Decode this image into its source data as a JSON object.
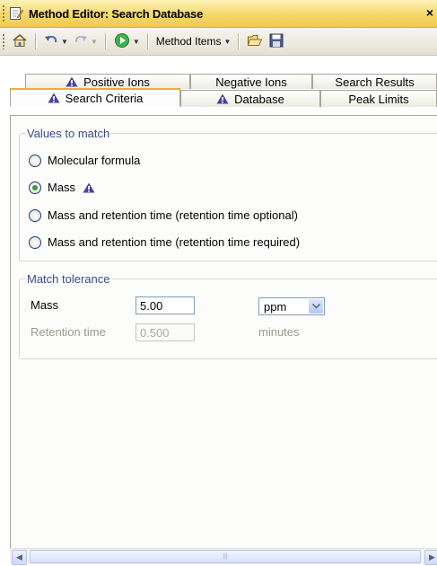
{
  "window": {
    "title": "Method Editor: Search Database",
    "close_label": "×"
  },
  "toolbar": {
    "method_items_label": "Method Items"
  },
  "tabs": {
    "row_back": [
      {
        "label": "Positive Ions",
        "warning": true
      },
      {
        "label": "Negative Ions",
        "warning": false
      },
      {
        "label": "Search Results",
        "warning": false
      }
    ],
    "row_front": [
      {
        "label": "Search Criteria",
        "warning": true,
        "active": true
      },
      {
        "label": "Database",
        "warning": true,
        "active": false
      },
      {
        "label": "Peak Limits",
        "warning": false,
        "active": false
      }
    ]
  },
  "values_to_match": {
    "legend": "Values to match",
    "options": [
      {
        "label": "Molecular formula",
        "checked": false,
        "warning": false
      },
      {
        "label": "Mass",
        "checked": true,
        "warning": true
      },
      {
        "label": "Mass and retention time (retention time optional)",
        "checked": false,
        "warning": false
      },
      {
        "label": "Mass and retention time (retention time required)",
        "checked": false,
        "warning": false
      }
    ]
  },
  "match_tolerance": {
    "legend": "Match tolerance",
    "mass_label": "Mass",
    "mass_value": "5.00",
    "mass_unit": "ppm",
    "rt_label": "Retention time",
    "rt_value": "0.500",
    "rt_unit": "minutes"
  },
  "colors": {
    "title_bar": "#f6d86a",
    "active_tab_accent": "#f2a93b",
    "warning_icon": "#4a3fa0",
    "group_legend": "#3b4a8a",
    "radio_checked": "#2ea33a"
  }
}
